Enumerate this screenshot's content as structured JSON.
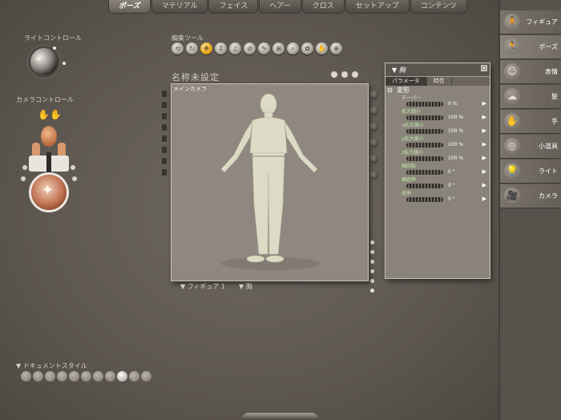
{
  "tabs": [
    {
      "label": "ポーズ",
      "active": true
    },
    {
      "label": "マテリアル",
      "active": false
    },
    {
      "label": "フェイス",
      "active": false
    },
    {
      "label": "ヘアー",
      "active": false
    },
    {
      "label": "クロス",
      "active": false
    },
    {
      "label": "セットアップ",
      "active": false
    },
    {
      "label": "コンテンツ",
      "active": false
    }
  ],
  "light_control": {
    "label": "ライトコントロール"
  },
  "camera_control": {
    "label": "カメラコントロール"
  },
  "edit_tools": {
    "label": "編集ツール",
    "tools": [
      "rotate-tool",
      "twist-tool",
      "translate-tool",
      "scale-tool",
      "taper-tool",
      "chain-break-tool",
      "color-tool",
      "grouping-tool",
      "view-magnifier-tool",
      "morph-brush-tool",
      "direct-manipulation-tool",
      "zoom-tool"
    ]
  },
  "document": {
    "title": "名称未設定",
    "viewport_label": "メインカメラ"
  },
  "viewport_menus": {
    "figure_menu": "フィギュア 1",
    "actor_menu": "胸"
  },
  "param_panel": {
    "title": "胸",
    "tabs": [
      "パラメータ",
      "特性"
    ],
    "section": "変形",
    "params": [
      {
        "name": "テーパー",
        "value": "0 %",
        "highlight": false
      },
      {
        "name": "拡大縮小",
        "value": "100 %",
        "highlight": true
      },
      {
        "name": "x拡大縮小",
        "value": "100 %",
        "highlight": true
      },
      {
        "name": "y拡大縮小",
        "value": "100 %",
        "highlight": true
      },
      {
        "name": "z拡大縮小",
        "value": "100 %",
        "highlight": true
      },
      {
        "name": "軸回転",
        "value": "0 °",
        "highlight": true
      },
      {
        "name": "横屈伸",
        "value": "0 °",
        "highlight": true
      },
      {
        "name": "屈伸",
        "value": "0 °",
        "highlight": true
      }
    ]
  },
  "document_style": {
    "label": "ドキュメントスタイル",
    "swatch_count": 11,
    "selected_index": 8
  },
  "rooms": [
    {
      "label": "フィギュア",
      "icon": "figure-icon",
      "glyph": "🧍"
    },
    {
      "label": "ポーズ",
      "icon": "pose-icon",
      "glyph": "🏃"
    },
    {
      "label": "表情",
      "icon": "face-icon",
      "glyph": "☺"
    },
    {
      "label": "髪",
      "icon": "hair-icon",
      "glyph": "☁"
    },
    {
      "label": "手",
      "icon": "hand-icon",
      "glyph": "✋"
    },
    {
      "label": "小道具",
      "icon": "props-icon",
      "glyph": "◎"
    },
    {
      "label": "ライト",
      "icon": "light-icon",
      "glyph": "💡"
    },
    {
      "label": "カメラ",
      "icon": "camera-icon",
      "glyph": "🎥"
    }
  ],
  "colors": {
    "accent": "#e2a41c",
    "background": "#5f5952",
    "viewport": "#908780"
  }
}
